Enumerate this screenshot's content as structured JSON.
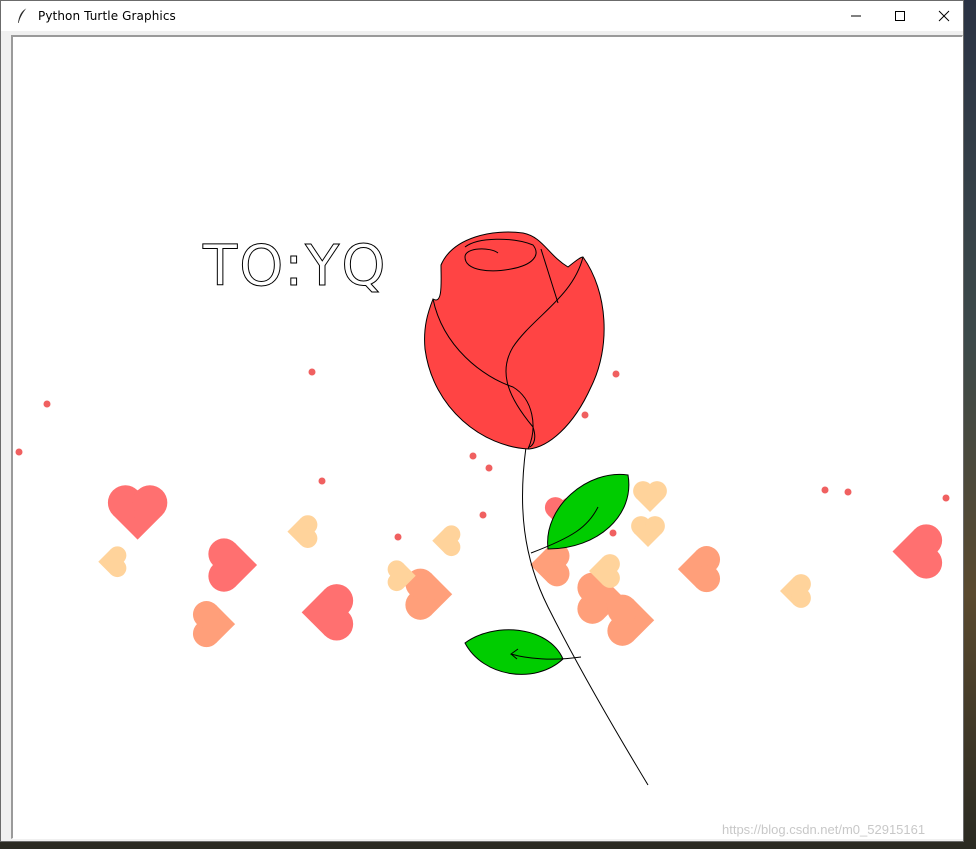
{
  "window": {
    "title": "Python Turtle Graphics",
    "icons": {
      "app": "feather-icon",
      "minimize": "minimize-icon",
      "maximize": "maximize-icon",
      "close": "close-icon"
    }
  },
  "canvas": {
    "greeting": "TO:YQ",
    "colors": {
      "rose": "#ff4444",
      "leaf": "#00cc00",
      "heart_pink": "#ff7070",
      "heart_salmon": "#ff9f7a",
      "heart_peach": "#ffd39b",
      "dot": "#f06060"
    }
  },
  "watermark": "https://blog.csdn.net/m0_52915161"
}
